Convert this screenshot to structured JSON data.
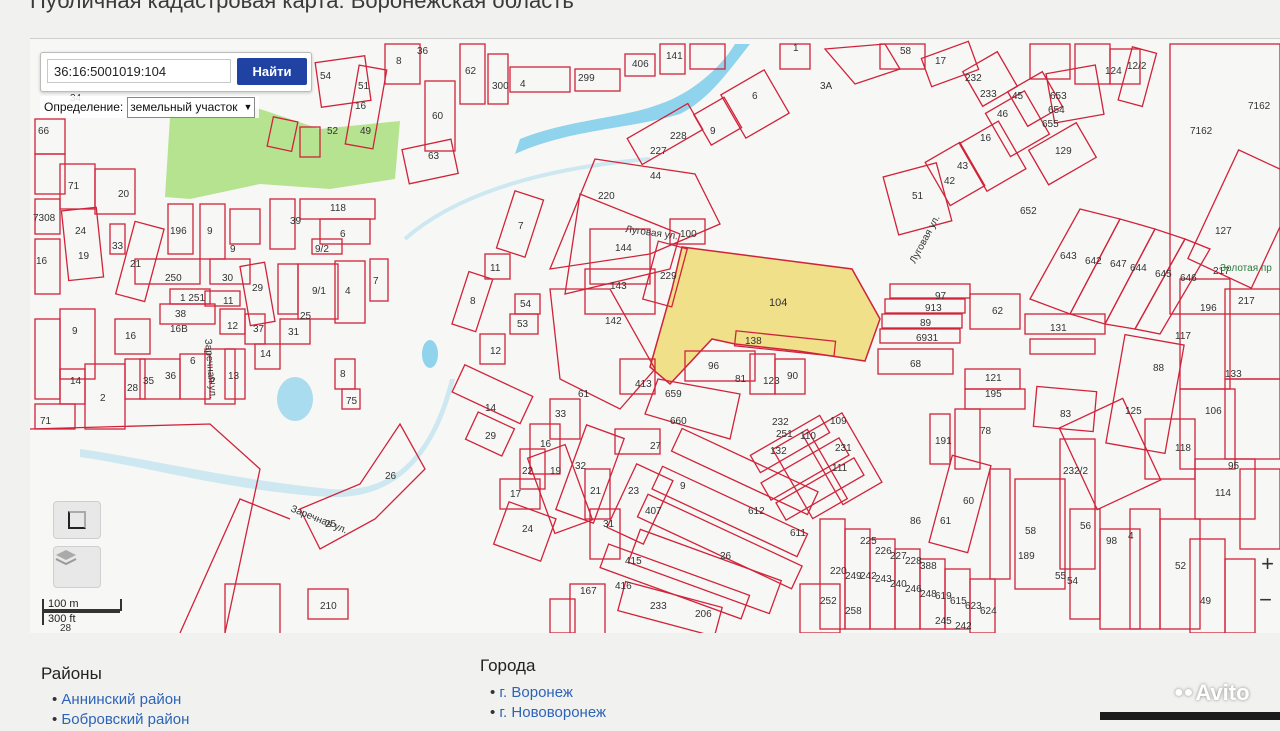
{
  "page": {
    "title": "Публичная кадастровая карта: Воронежская область"
  },
  "search": {
    "value": "36:16:5001019:104",
    "button": "Найти"
  },
  "definition": {
    "label": "Определение:",
    "selected": "земельный участок"
  },
  "scale": {
    "metric": "100 m",
    "imperial": "300 ft"
  },
  "zoom": {
    "in": "+",
    "out": "−"
  },
  "map": {
    "selected_parcel": "104",
    "streets": [
      "Луговая ул.",
      "Луговая ул.",
      "Заречная ул.",
      "Заречная ул."
    ],
    "labels": [
      "54",
      "51",
      "16",
      "52",
      "49",
      "8",
      "36",
      "60",
      "63",
      "62",
      "300",
      "4",
      "299",
      "406",
      "141",
      "3А",
      "58",
      "17",
      "232",
      "233",
      "45",
      "46",
      "16",
      "43",
      "42",
      "51",
      "1",
      "12/2",
      "124",
      "7162",
      "653",
      "654",
      "655",
      "129",
      "652",
      "7162",
      "66",
      "71",
      "20",
      "7308",
      "24",
      "19",
      "33",
      "196",
      "9",
      "39",
      "118",
      "6",
      "9/2",
      "21",
      "250",
      "1",
      "251",
      "30",
      "11",
      "29",
      "9/1",
      "4",
      "7",
      "38",
      "16",
      "12",
      "37",
      "31",
      "25",
      "9",
      "16",
      "14",
      "35",
      "28",
      "36",
      "6",
      "2",
      "13",
      "14",
      "8",
      "75",
      "2",
      "44",
      "220",
      "227",
      "228",
      "9",
      "6",
      "7",
      "144",
      "100",
      "229",
      "143",
      "11",
      "54",
      "53",
      "8",
      "12",
      "142",
      "104",
      "138",
      "96",
      "81",
      "123",
      "90",
      "413",
      "659",
      "660",
      "61",
      "14",
      "33",
      "29",
      "16",
      "22",
      "19",
      "32",
      "21",
      "17",
      "24",
      "23",
      "31",
      "27",
      "407",
      "9",
      "612",
      "611",
      "26",
      "415",
      "416",
      "233",
      "206",
      "210",
      "26",
      "25",
      "97",
      "913",
      "89",
      "6931",
      "68",
      "62",
      "131",
      "121",
      "195",
      "83",
      "191",
      "78",
      "60",
      "232/2",
      "61",
      "58",
      "189",
      "56",
      "55",
      "54",
      "98",
      "52",
      "49",
      "8",
      "125",
      "106",
      "118",
      "114",
      "95",
      "133",
      "117",
      "196",
      "88",
      "127",
      "217",
      "643",
      "642",
      "647",
      "644",
      "645",
      "646",
      "232",
      "109",
      "251",
      "110",
      "231",
      "132",
      "111",
      "167",
      "28",
      "26",
      "220",
      "249",
      "242",
      "243",
      "240",
      "246",
      "248",
      "619",
      "615",
      "623",
      "624",
      "225",
      "226",
      "227",
      "228",
      "388",
      "252",
      "258",
      "245",
      "242",
      "86",
      "Золотая пр"
    ]
  },
  "districts": {
    "title": "Районы",
    "items": [
      "Аннинский район",
      "Бобровский район"
    ]
  },
  "cities": {
    "title": "Города",
    "items": [
      "г. Воронеж",
      "г. Нововоронеж"
    ]
  },
  "watermark": "Avito",
  "colors": {
    "parcel_border": "#d0233a",
    "selected_fill": "#f0e08a",
    "water": "#8fd3ec",
    "green": "#b6e38f",
    "button": "#2043a3",
    "link": "#2d64b8"
  }
}
